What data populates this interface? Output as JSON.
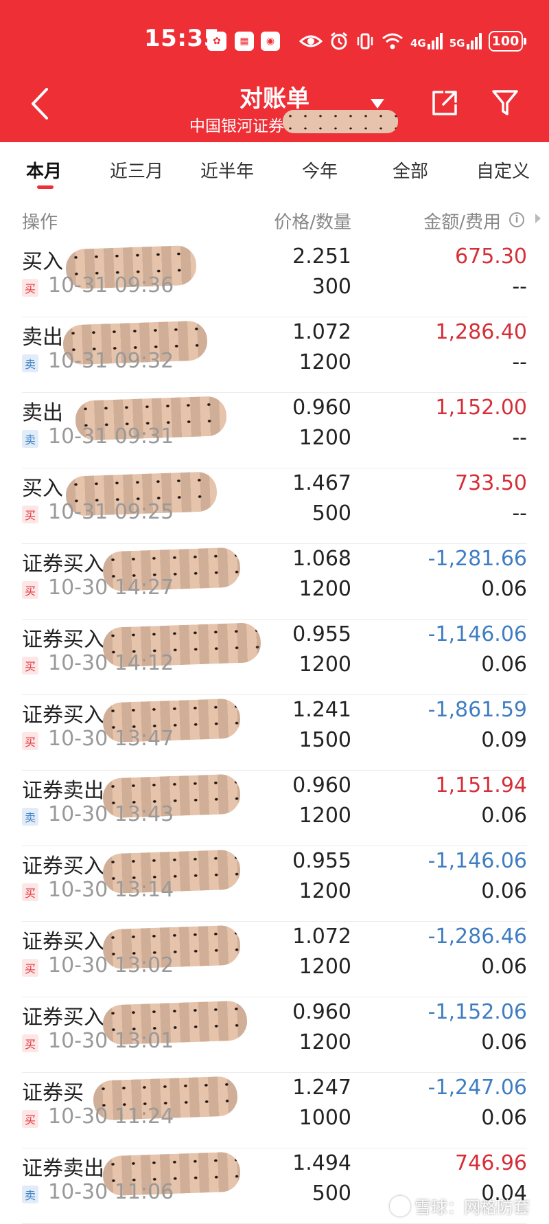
{
  "status_bar": {
    "time": "15:35",
    "network_1": "4G",
    "network_2": "5G",
    "battery": "100"
  },
  "header": {
    "title": "对账单",
    "subtitle": "中国银河证券"
  },
  "tabs": [
    {
      "label": "本月",
      "active": true
    },
    {
      "label": "近三月",
      "active": false
    },
    {
      "label": "近半年",
      "active": false
    },
    {
      "label": "今年",
      "active": false
    },
    {
      "label": "全部",
      "active": false
    },
    {
      "label": "自定义",
      "active": false
    }
  ],
  "columns": {
    "operation": "操作",
    "price_qty": "价格/数量",
    "amount_fee": "金额/费用",
    "info_icon": "i"
  },
  "colors": {
    "header_bg": "#ee2f36",
    "amount_red": "#d62e38",
    "amount_blue": "#3f7dc2"
  },
  "rows": [
    {
      "op": "买入",
      "type": "买",
      "kind": "buy",
      "time": "10-31 09:36",
      "price": "2.251",
      "qty": "300",
      "amount": "675.30",
      "amount_color": "red",
      "fee": "--"
    },
    {
      "op": "卖出",
      "type": "卖",
      "kind": "sell",
      "time": "10-31 09:32",
      "price": "1.072",
      "qty": "1200",
      "amount": "1,286.40",
      "amount_color": "red",
      "fee": "--"
    },
    {
      "op": "卖出",
      "type": "卖",
      "kind": "sell",
      "time": "10-31 09:31",
      "price": "0.960",
      "qty": "1200",
      "amount": "1,152.00",
      "amount_color": "red",
      "fee": "--"
    },
    {
      "op": "买入",
      "type": "买",
      "kind": "buy",
      "time": "10-31 09:25",
      "price": "1.467",
      "qty": "500",
      "amount": "733.50",
      "amount_color": "red",
      "fee": "--"
    },
    {
      "op": "证券买入",
      "type": "买",
      "kind": "buy",
      "time": "10-30 14:27",
      "price": "1.068",
      "qty": "1200",
      "amount": "-1,281.66",
      "amount_color": "blue",
      "fee": "0.06"
    },
    {
      "op": "证券买入",
      "type": "买",
      "kind": "buy",
      "time": "10-30 14:12",
      "price": "0.955",
      "qty": "1200",
      "amount": "-1,146.06",
      "amount_color": "blue",
      "fee": "0.06"
    },
    {
      "op": "证券买入",
      "type": "买",
      "kind": "buy",
      "time": "10-30 13:47",
      "price": "1.241",
      "qty": "1500",
      "amount": "-1,861.59",
      "amount_color": "blue",
      "fee": "0.09"
    },
    {
      "op": "证券卖出",
      "type": "卖",
      "kind": "sell",
      "time": "10-30 13:43",
      "price": "0.960",
      "qty": "1200",
      "amount": "1,151.94",
      "amount_color": "red",
      "fee": "0.06"
    },
    {
      "op": "证券买入",
      "type": "买",
      "kind": "buy",
      "time": "10-30 13:14",
      "price": "0.955",
      "qty": "1200",
      "amount": "-1,146.06",
      "amount_color": "blue",
      "fee": "0.06"
    },
    {
      "op": "证券买入",
      "type": "买",
      "kind": "buy",
      "time": "10-30 13:02",
      "price": "1.072",
      "qty": "1200",
      "amount": "-1,286.46",
      "amount_color": "blue",
      "fee": "0.06"
    },
    {
      "op": "证券买入",
      "type": "买",
      "kind": "buy",
      "time": "10-30 13:01",
      "price": "0.960",
      "qty": "1200",
      "amount": "-1,152.06",
      "amount_color": "blue",
      "fee": "0.06"
    },
    {
      "op": "证券买",
      "type": "买",
      "kind": "buy",
      "time": "10-30 11:24",
      "price": "1.247",
      "qty": "1000",
      "amount": "-1,247.06",
      "amount_color": "blue",
      "fee": "0.06"
    },
    {
      "op": "证券卖出",
      "type": "卖",
      "kind": "sell",
      "time": "10-30 11:06",
      "price": "1.494",
      "qty": "500",
      "amount": "746.96",
      "amount_color": "red",
      "fee": "0.04"
    }
  ],
  "watermark": "雪球：网格防套"
}
